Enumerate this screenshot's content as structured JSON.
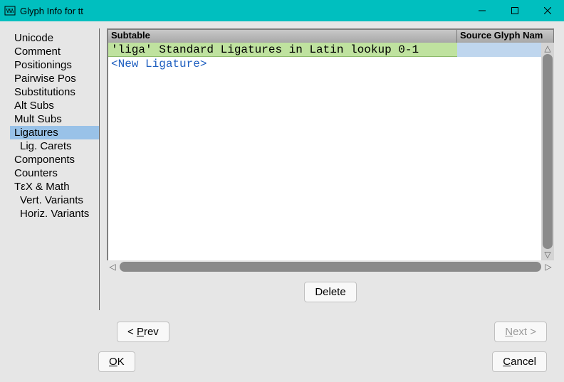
{
  "window": {
    "title": "Glyph Info for tt"
  },
  "sidebar": {
    "items": [
      {
        "label": "Unicode",
        "indent": false,
        "selected": false
      },
      {
        "label": "Comment",
        "indent": false,
        "selected": false
      },
      {
        "label": "Positionings",
        "indent": false,
        "selected": false
      },
      {
        "label": "Pairwise Pos",
        "indent": false,
        "selected": false
      },
      {
        "label": "Substitutions",
        "indent": false,
        "selected": false
      },
      {
        "label": "Alt Subs",
        "indent": false,
        "selected": false
      },
      {
        "label": "Mult Subs",
        "indent": false,
        "selected": false
      },
      {
        "label": "Ligatures",
        "indent": false,
        "selected": true
      },
      {
        "label": "Lig. Carets",
        "indent": true,
        "selected": false
      },
      {
        "label": "Components",
        "indent": false,
        "selected": false
      },
      {
        "label": "Counters",
        "indent": false,
        "selected": false
      },
      {
        "label": "TεX & Math",
        "indent": false,
        "selected": false
      },
      {
        "label": "Vert. Variants",
        "indent": true,
        "selected": false
      },
      {
        "label": "Horiz. Variants",
        "indent": true,
        "selected": false
      }
    ]
  },
  "table": {
    "columns": {
      "subtable": "Subtable",
      "source": "Source Glyph Nam"
    },
    "rows": [
      {
        "subtable": "'liga' Standard Ligatures in Latin lookup 0-1",
        "source": "",
        "selected": true
      },
      {
        "subtable": "<New Ligature>",
        "source": "",
        "new": true
      }
    ]
  },
  "buttons": {
    "delete": "Delete",
    "prev_pre": "< ",
    "prev_mnem": "P",
    "prev_post": "rev",
    "next_pre": "",
    "next_mnem": "N",
    "next_post": "ext >",
    "ok_pre": "",
    "ok_mnem": "O",
    "ok_post": "K",
    "cancel_pre": "",
    "cancel_mnem": "C",
    "cancel_post": "ancel"
  }
}
